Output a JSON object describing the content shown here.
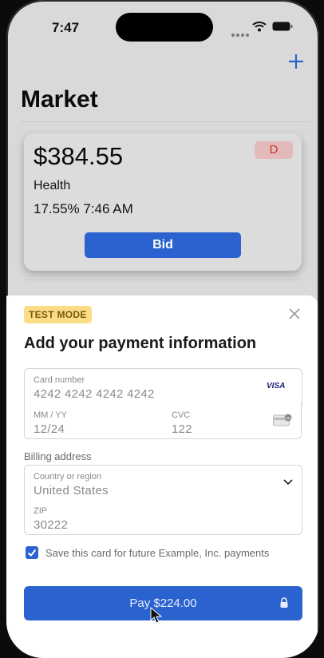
{
  "status_bar": {
    "time": "7:47"
  },
  "header": {
    "title": "Market",
    "add_icon": "plus-icon"
  },
  "card": {
    "price": "$384.55",
    "badge": "D",
    "category": "Health",
    "stats": "17.55%  7:46 AM",
    "bid_label": "Bid"
  },
  "payment": {
    "mode_badge": "TEST MODE",
    "heading": "Add your payment information",
    "card_number_label": "Card number",
    "card_number_value": "4242 4242 4242 4242",
    "card_brand": "VISA",
    "expiry_label": "MM / YY",
    "expiry_value": "12/24",
    "cvc_label": "CVC",
    "cvc_value": "122",
    "billing_label": "Billing address",
    "country_label": "Country or region",
    "country_value": "United States",
    "zip_label": "ZIP",
    "zip_value": "30222",
    "save_checked": true,
    "save_label": "Save this card for future Example, Inc. payments",
    "pay_label": "Pay $224.00"
  },
  "colors": {
    "accent": "#2a62cf",
    "badge_bg": "#fbdd86",
    "d_badge": "#d03030"
  }
}
